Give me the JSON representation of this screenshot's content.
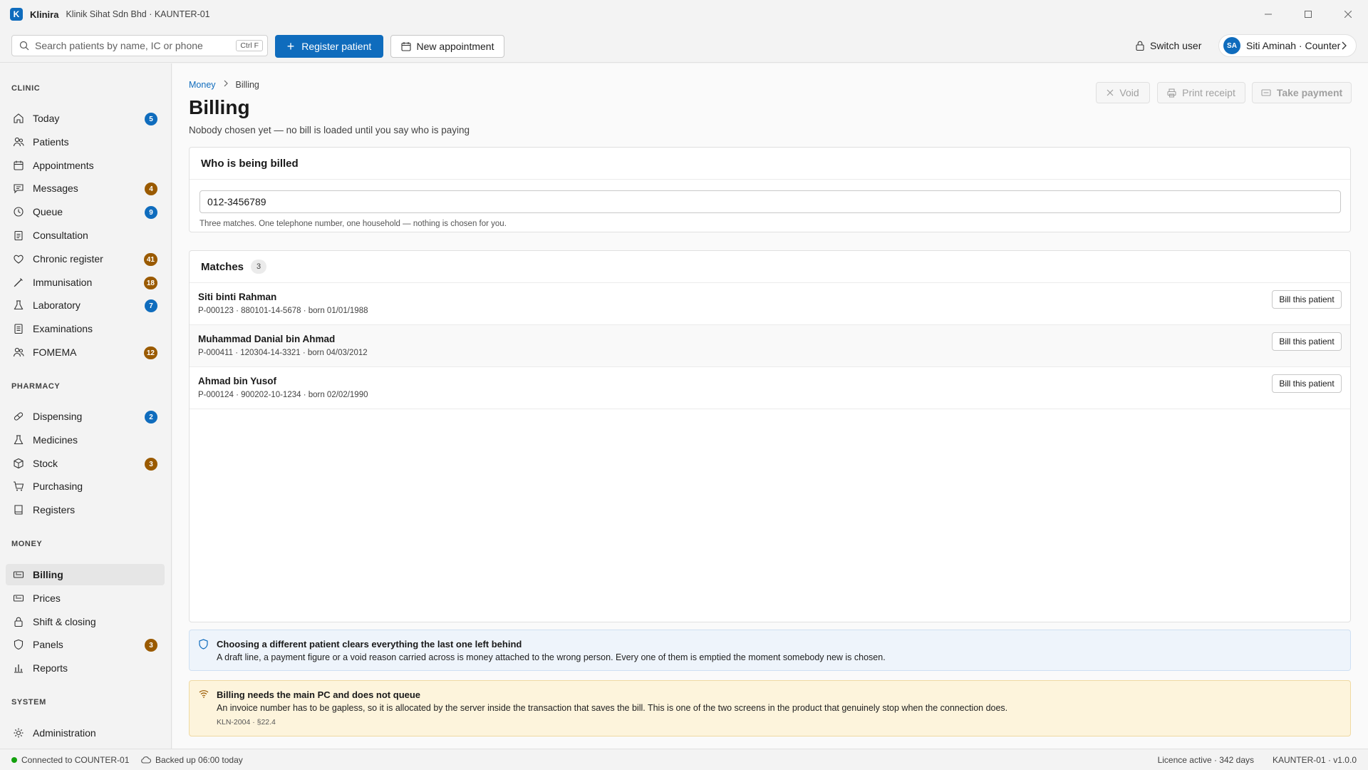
{
  "app": {
    "name": "Klinira",
    "logo_letter": "K",
    "subtitle": "Klinik Sihat Sdn Bhd · KAUNTER-01"
  },
  "toolbar": {
    "search_placeholder": "Search patients by name, IC or phone",
    "search_shortcut": "Ctrl F",
    "register_label": "Register patient",
    "appointment_label": "New appointment",
    "switch_user_label": "Switch user",
    "user_initials": "SA",
    "user_label": "Siti Aminah · Counter"
  },
  "sidebar": {
    "sections": [
      {
        "title": "CLINIC",
        "items": [
          {
            "label": "Today",
            "icon": "home-icon",
            "badge": "5",
            "badge_color": "blue"
          },
          {
            "label": "Patients",
            "icon": "people-icon",
            "badge": "",
            "badge_color": ""
          },
          {
            "label": "Appointments",
            "icon": "calendar-icon",
            "badge": "",
            "badge_color": ""
          },
          {
            "label": "Messages",
            "icon": "chat-icon",
            "badge": "4",
            "badge_color": "amber"
          },
          {
            "label": "Queue",
            "icon": "clock-icon",
            "badge": "9",
            "badge_color": "blue"
          },
          {
            "label": "Consultation",
            "icon": "clipboard-icon",
            "badge": "",
            "badge_color": ""
          },
          {
            "label": "Chronic register",
            "icon": "heart-icon",
            "badge": "41",
            "badge_color": "amber"
          },
          {
            "label": "Immunisation",
            "icon": "syringe-icon",
            "badge": "18",
            "badge_color": "amber"
          },
          {
            "label": "Laboratory",
            "icon": "flask-icon",
            "badge": "7",
            "badge_color": "blue"
          },
          {
            "label": "Examinations",
            "icon": "document-icon",
            "badge": "",
            "badge_color": ""
          },
          {
            "label": "FOMEMA",
            "icon": "people-icon",
            "badge": "12",
            "badge_color": "amber"
          }
        ]
      },
      {
        "title": "PHARMACY",
        "items": [
          {
            "label": "Dispensing",
            "icon": "pill-icon",
            "badge": "2",
            "badge_color": "blue"
          },
          {
            "label": "Medicines",
            "icon": "flask-icon",
            "badge": "",
            "badge_color": ""
          },
          {
            "label": "Stock",
            "icon": "box-icon",
            "badge": "3",
            "badge_color": "amber"
          },
          {
            "label": "Purchasing",
            "icon": "cart-icon",
            "badge": "",
            "badge_color": ""
          },
          {
            "label": "Registers",
            "icon": "book-icon",
            "badge": "",
            "badge_color": ""
          }
        ]
      },
      {
        "title": "MONEY",
        "items": [
          {
            "label": "Billing",
            "icon": "money-icon",
            "badge": "",
            "badge_color": "",
            "active": true
          },
          {
            "label": "Prices",
            "icon": "money-icon",
            "badge": "",
            "badge_color": ""
          },
          {
            "label": "Shift & closing",
            "icon": "lock-icon",
            "badge": "",
            "badge_color": ""
          },
          {
            "label": "Panels",
            "icon": "shield-icon",
            "badge": "3",
            "badge_color": "amber"
          },
          {
            "label": "Reports",
            "icon": "chart-icon",
            "badge": "",
            "badge_color": ""
          }
        ]
      },
      {
        "title": "SYSTEM",
        "items": [
          {
            "label": "Administration",
            "icon": "gear-icon",
            "badge": "",
            "badge_color": ""
          }
        ]
      }
    ]
  },
  "breadcrumb": {
    "parent": "Money",
    "current": "Billing"
  },
  "page": {
    "title": "Billing",
    "subtitle": "Nobody chosen yet — no bill is loaded until you say who is paying"
  },
  "header_actions": {
    "void_label": "Void",
    "print_label": "Print receipt",
    "payment_label": "Take payment"
  },
  "who_card": {
    "title": "Who is being billed",
    "input_value": "012-3456789",
    "hint": "Three matches. One telephone number, one household — nothing is chosen for you."
  },
  "matches": {
    "title": "Matches",
    "count": "3",
    "button_label": "Bill this patient",
    "rows": [
      {
        "name": "Siti binti Rahman",
        "meta": "P-000123 · 880101-14-5678 · born 01/01/1988"
      },
      {
        "name": "Muhammad Danial bin Ahmad",
        "meta": "P-000411 · 120304-14-3321 · born 04/03/2012"
      },
      {
        "name": "Ahmad bin Yusof",
        "meta": "P-000124 · 900202-10-1234 · born 02/02/1990"
      }
    ]
  },
  "notice_info": {
    "title": "Choosing a different patient clears everything the last one left behind",
    "body": "A draft line, a payment figure or a void reason carried across is money attached to the wrong person. Every one of them is emptied the moment somebody new is chosen."
  },
  "notice_warning": {
    "title": "Billing needs the main PC and does not queue",
    "body": "An invoice number has to be gapless, so it is allocated by the server inside the transaction that saves the bill. This is one of the two screens in the product that genuinely stop when the connection does.",
    "ref": "KLN-2004 · §22.4"
  },
  "status": {
    "connection": "Connected to COUNTER-01",
    "backup": "Backed up 06:00 today",
    "licence": "Licence active · 342 days",
    "version": "KAUNTER-01 · v1.0.0"
  },
  "colors": {
    "accent": "#0f6cbd",
    "badge_amber": "#9a5a00",
    "info_bg": "#eef4fb",
    "warning_bg": "#fdf4dc",
    "online": "#13a10e"
  }
}
